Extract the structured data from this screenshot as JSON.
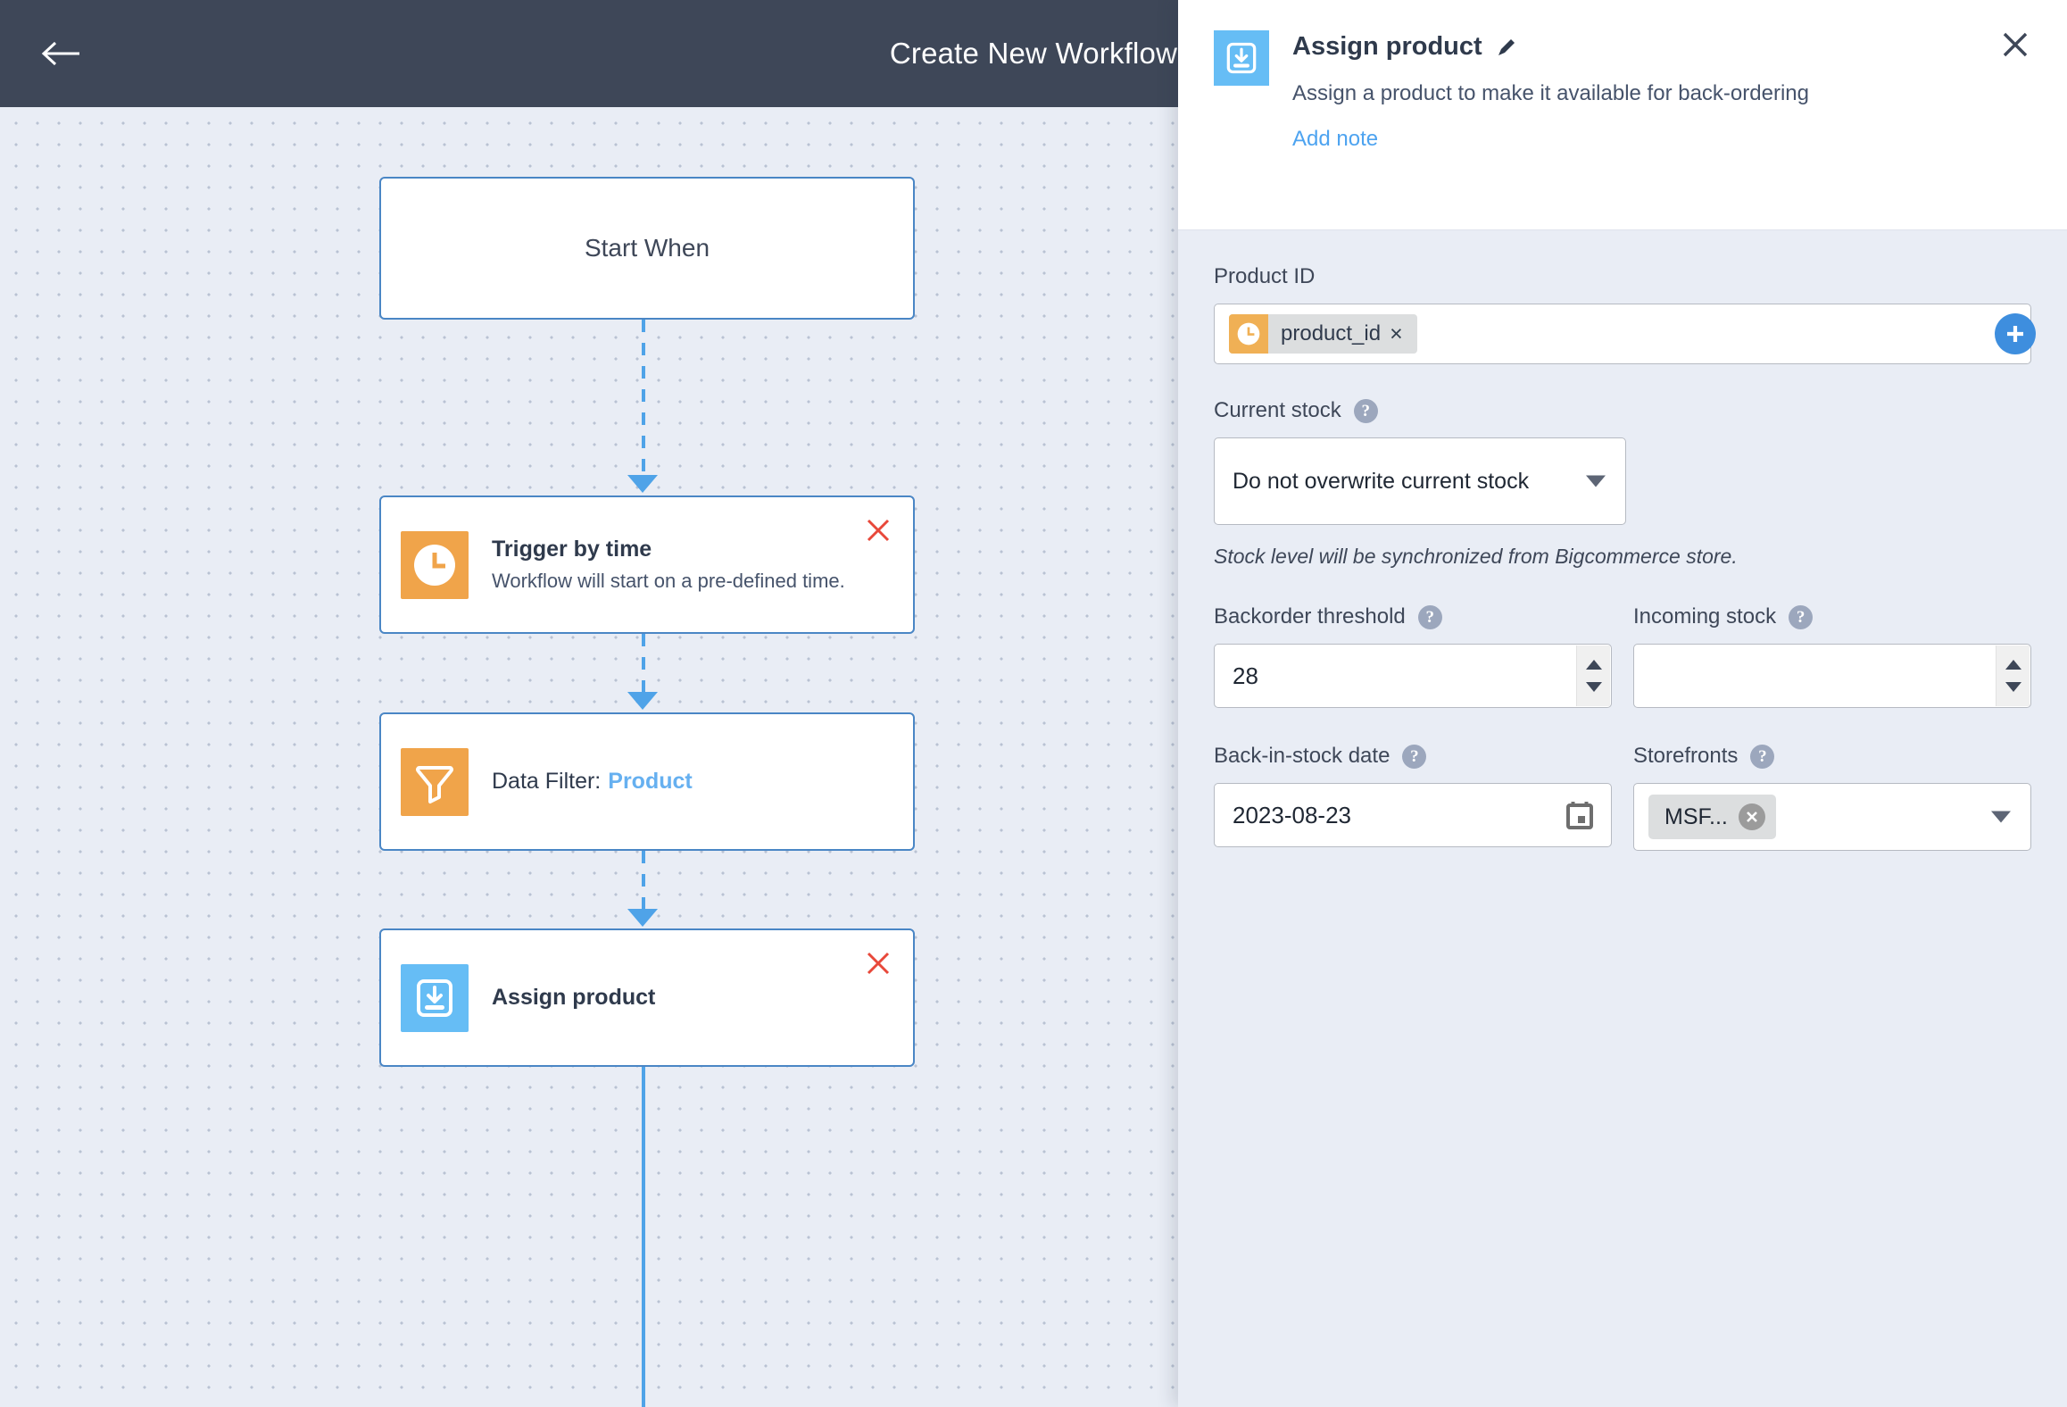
{
  "topbar": {
    "title": "Create New Workflow",
    "back_icon": "arrow-left-icon"
  },
  "canvas": {
    "nodes": [
      {
        "id": "start",
        "label": "Start When"
      },
      {
        "id": "trigger",
        "title": "Trigger by time",
        "desc": "Workflow will start on a pre-defined time.",
        "icon": "clock-icon",
        "close_icon": "close-icon"
      },
      {
        "id": "filter",
        "prefix": "Data Filter:",
        "highlight": "Product",
        "icon": "funnel-icon"
      },
      {
        "id": "assign",
        "title": "Assign product",
        "icon": "download-tray-icon",
        "close_icon": "close-icon"
      }
    ]
  },
  "panel": {
    "icon": "download-tray-icon",
    "title": "Assign product",
    "edit_icon": "pencil-icon",
    "description": "Assign a product to make it available for back-ordering",
    "add_note": "Add note",
    "close_icon": "close-icon",
    "fields": {
      "product_id": {
        "label": "Product ID",
        "chip_label": "product_id",
        "chip_icon": "clock-icon",
        "chip_remove": "×",
        "add_button": "+"
      },
      "current_stock": {
        "label": "Current stock",
        "help": "?",
        "value": "Do not overwrite current stock",
        "helper_text": "Stock level will be synchronized from Bigcommerce store."
      },
      "backorder_threshold": {
        "label": "Backorder threshold",
        "help": "?",
        "value": "28"
      },
      "incoming_stock": {
        "label": "Incoming stock",
        "help": "?",
        "value": ""
      },
      "back_in_stock_date": {
        "label": "Back-in-stock date",
        "help": "?",
        "value": "2023-08-23",
        "icon": "calendar-icon"
      },
      "storefronts": {
        "label": "Storefronts",
        "help": "?",
        "chip_label": "MSF...",
        "chip_remove": "×"
      }
    }
  },
  "colors": {
    "header_bg": "#3e4758",
    "canvas_bg": "#e9edf5",
    "node_border": "#4a86c5",
    "connector": "#4fa3e8",
    "accent_blue": "#3e8ede",
    "link_blue": "#4da3f0",
    "icon_orange": "#f0a44a",
    "icon_blue": "#66bdf5",
    "delete_red": "#e8483a"
  }
}
